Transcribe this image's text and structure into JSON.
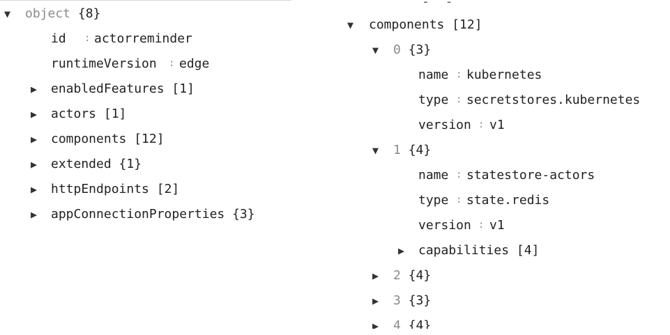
{
  "left_tree": {
    "root": {
      "key": "object",
      "meta": "{8}"
    },
    "fields": [
      {
        "key": "id",
        "value": "actorreminder"
      },
      {
        "key": "runtimeVersion",
        "value": "edge"
      }
    ],
    "collapsed": [
      {
        "key": "enabledFeatures",
        "meta": "[1]"
      },
      {
        "key": "actors",
        "meta": "[1]"
      },
      {
        "key": "components",
        "meta": "[12]"
      },
      {
        "key": "extended",
        "meta": "{1}"
      },
      {
        "key": "httpEndpoints",
        "meta": "[2]"
      },
      {
        "key": "appConnectionProperties",
        "meta": "{3}"
      }
    ]
  },
  "right_tree": {
    "components": {
      "key": "components",
      "meta": "[12]"
    },
    "item0": {
      "index": "0",
      "meta": "{3}",
      "fields": [
        {
          "key": "name",
          "value": "kubernetes"
        },
        {
          "key": "type",
          "value": "secretstores.kubernetes"
        },
        {
          "key": "version",
          "value": "v1"
        }
      ]
    },
    "item1": {
      "index": "1",
      "meta": "{4}",
      "fields": [
        {
          "key": "name",
          "value": "statestore-actors"
        },
        {
          "key": "type",
          "value": "state.redis"
        },
        {
          "key": "version",
          "value": "v1"
        }
      ],
      "capabilities": {
        "key": "capabilities",
        "meta": "[4]"
      }
    },
    "collapsed_items": [
      {
        "index": "2",
        "meta": "{4}"
      },
      {
        "index": "3",
        "meta": "{3}"
      },
      {
        "index": "4",
        "meta": "{4}"
      }
    ]
  },
  "glyphs": {
    "expanded": "▼",
    "collapsed": "▶",
    "colon": ":"
  },
  "icons": {
    "expanded": "triangle-down-icon",
    "collapsed": "triangle-right-icon"
  },
  "colors": {
    "key": "#222222",
    "muted": "#8a8a8a",
    "separator": "#888888"
  }
}
